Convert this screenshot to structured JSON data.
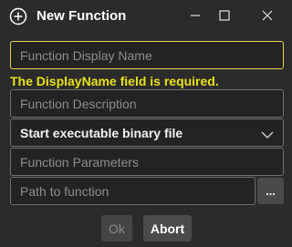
{
  "window": {
    "title": "New Function",
    "icons": {
      "title": "plus-circle-icon",
      "minimize": "minimize-icon",
      "maximize": "maximize-icon",
      "close": "close-icon"
    }
  },
  "form": {
    "display_name": {
      "placeholder": "Function Display Name",
      "value": ""
    },
    "error_message": "The DisplayName field is required.",
    "description": {
      "placeholder": "Function Description",
      "value": ""
    },
    "type_select": {
      "selected": "Start executable binary file"
    },
    "parameters": {
      "placeholder": "Function Parameters",
      "value": ""
    },
    "path": {
      "placeholder": "Path to function",
      "value": ""
    },
    "browse_label": "..."
  },
  "buttons": {
    "ok_label": "Ok",
    "abort_label": "Abort"
  },
  "colors": {
    "background": "#2b2b2b",
    "error": "#e8e21a",
    "error_border": "#e8d44d",
    "field_border": "#6f6f6f"
  }
}
